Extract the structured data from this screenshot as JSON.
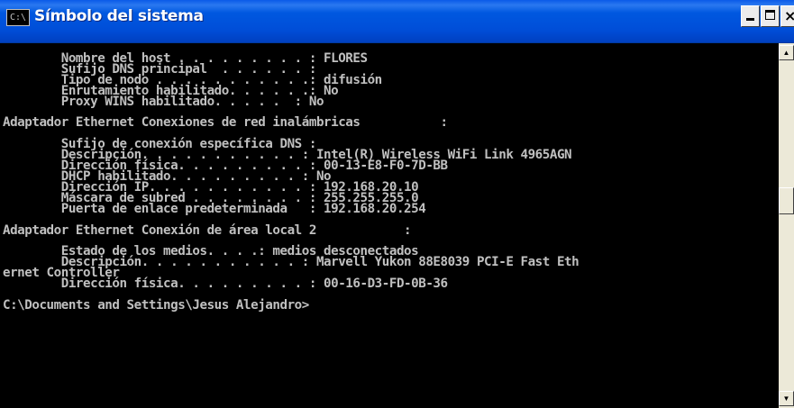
{
  "window": {
    "title": "Símbolo del sistema",
    "icon_label": "C:\\",
    "icons": {
      "app": "cmd-icon",
      "minimize": "minimize-icon",
      "maximize": "maximize-icon",
      "close": "close-icon",
      "scroll_up": "arrow-up-icon",
      "scroll_down": "arrow-down-icon"
    },
    "colors": {
      "titlebar": "#0054e3",
      "console_bg": "#000000",
      "console_fg": "#c0c0c0"
    }
  },
  "console": {
    "lines": [
      "        Nombre del host . . . . . . . . . : FLORES",
      "        Sufijo DNS principal  . . . . . . :",
      "        Tipo de nodo . . . . . . . . . . .: difusión",
      "        Enrutamiento habilitado. . . . . .: No",
      "        Proxy WINS habilitado. . . . .  : No",
      "",
      "Adaptador Ethernet Conexiones de red inalámbricas           :",
      "",
      "        Sufijo de conexión específica DNS :",
      "        Descripción. . . . . . . . . . . : Intel(R) Wireless WiFi Link 4965AGN",
      "        Dirección física. . . . . . . . . : 00-13-E8-F0-7D-BB",
      "        DHCP habilitado. . . . . . . . . : No",
      "        Dirección IP. . . . . . . . . . . : 192.168.20.10",
      "        Máscara de subred . . . . . . . . : 255.255.255.0",
      "        Puerta de enlace predeterminada   : 192.168.20.254",
      "",
      "Adaptador Ethernet Conexión de área local 2            :",
      "",
      "        Estado de los medios. . . .: medios desconectados",
      "        Descripción. . . . . . . . . . . : Marvell Yukon 88E8039 PCI-E Fast Eth",
      "ernet Controller",
      "        Dirección física. . . . . . . . . : 00-16-D3-FD-0B-36",
      "",
      "C:\\Documents and Settings\\Jesus Alejandro>"
    ]
  }
}
